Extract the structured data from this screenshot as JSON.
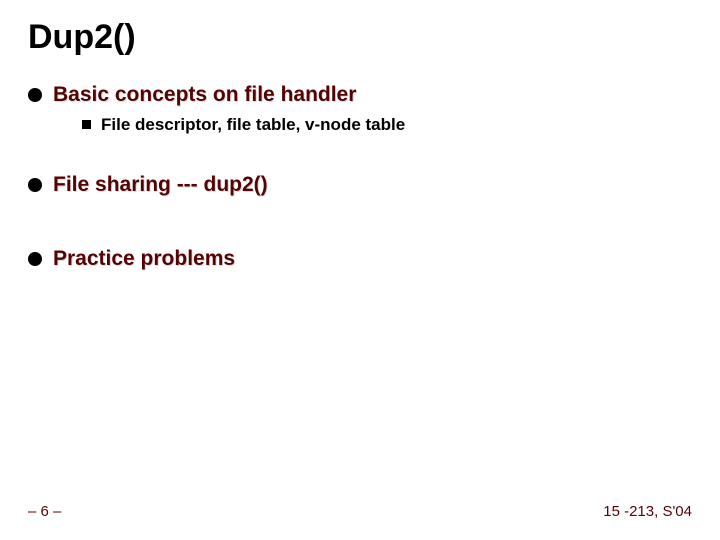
{
  "title": "Dup2()",
  "bullets": [
    {
      "text": "Basic concepts on file handler",
      "children": [
        {
          "text": "File descriptor, file table, v-node table"
        }
      ]
    },
    {
      "text": "File sharing --- dup2()"
    },
    {
      "text": "Practice problems"
    }
  ],
  "footer": {
    "left": "– 6 –",
    "right": "15 -213, S'04"
  }
}
